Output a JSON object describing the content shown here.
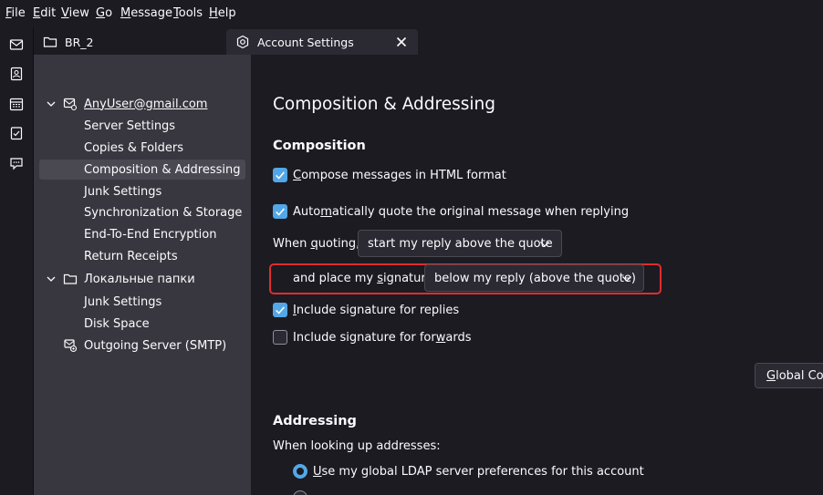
{
  "menubar": {
    "items": [
      {
        "label": "File",
        "mnemonic": "F",
        "rest": "ile"
      },
      {
        "label": "Edit",
        "mnemonic": "E",
        "rest": "dit"
      },
      {
        "label": "View",
        "mnemonic": "V",
        "rest": "iew"
      },
      {
        "label": "Go",
        "mnemonic": "G",
        "rest": "o"
      },
      {
        "label": "Message",
        "mnemonic": "M",
        "rest": "essage"
      },
      {
        "label": "Tools",
        "mnemonic": "T",
        "rest": "ools"
      },
      {
        "label": "Help",
        "mnemonic": "H",
        "rest": "elp"
      }
    ]
  },
  "spaces": [
    "mail-icon",
    "address-book-icon",
    "calendar-icon",
    "tasks-icon",
    "chat-icon"
  ],
  "tabs": [
    {
      "label": "BR_2",
      "icon": "folder-icon"
    },
    {
      "label": "Account Settings",
      "icon": "gear-icon",
      "active": true
    }
  ],
  "tree": {
    "account": "AnyUser@gmail.com",
    "account_items": [
      "Server Settings",
      "Copies & Folders",
      "Composition & Addressing",
      "Junk Settings",
      "Synchronization & Storage",
      "End-To-End Encryption",
      "Return Receipts"
    ],
    "local_folders": "Локальные папки",
    "local_items": [
      "Junk Settings",
      "Disk Space"
    ],
    "outgoing": "Outgoing Server (SMTP)"
  },
  "content": {
    "page_title": "Composition & Addressing",
    "composition": {
      "title": "Composition",
      "html_format": {
        "pre": "",
        "key": "C",
        "post": "ompose messages in HTML format",
        "checked": true
      },
      "auto_quote": {
        "pre": "Auto",
        "key": "m",
        "post": "atically quote the original message when replying",
        "checked": true
      },
      "when_quoting": {
        "pre": "When ",
        "key": "q",
        "post": "uoting,"
      },
      "quote_select": "start my reply above the quote",
      "signature": {
        "pre": "and place my ",
        "key": "s",
        "post": "ignature"
      },
      "signature_select": "below my reply (above the quote)",
      "sig_replies": {
        "pre": "",
        "key": "I",
        "post": "nclude signature for replies",
        "checked": true
      },
      "sig_forwards": {
        "pre": "Include signature for for",
        "key": "w",
        "post": "ards",
        "checked": false
      },
      "global_button": {
        "key": "G",
        "post": "lobal Con"
      }
    },
    "addressing": {
      "title": "Addressing",
      "lookup_label": "When looking up addresses:",
      "use_global": {
        "key": "U",
        "post": "se my global LDAP server preferences for this account",
        "selected": true
      }
    }
  },
  "colors": {
    "accent": "#53a7e6",
    "highlight": "#e02d2d",
    "sidebar": "#38373f",
    "background": "#1c1b22"
  }
}
